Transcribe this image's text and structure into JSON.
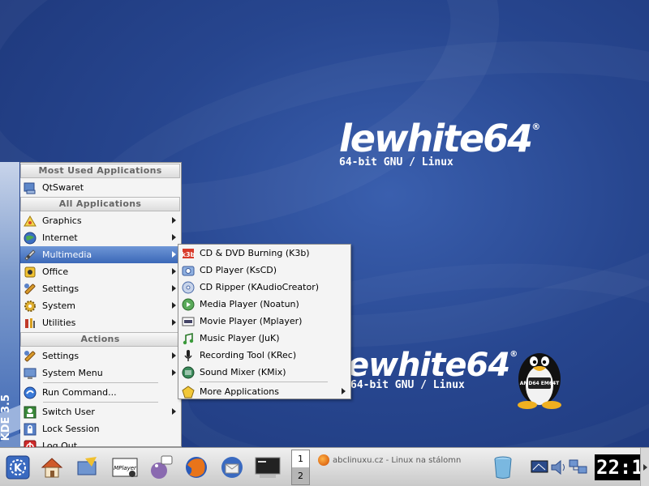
{
  "desktop": {
    "brand_top": "lewhite64",
    "brand_top_mark": "®",
    "sub_top": "64-bit GNU / Linux",
    "brand_bottom": "ewhite64",
    "brand_bottom_mark": "®",
    "sub_bottom": "64-bit GNU / Linux",
    "tux_badge": "AMD64 EM64T"
  },
  "sidebar": {
    "label": "KDE 3.5"
  },
  "menu": {
    "header_most_used": "Most Used Applications",
    "most_used": [
      {
        "label": "QtSwaret",
        "icon": "qtswaret-icon"
      }
    ],
    "header_all": "All Applications",
    "all": [
      {
        "label": "Graphics",
        "icon": "graphics-icon",
        "submenu": true
      },
      {
        "label": "Internet",
        "icon": "internet-globe-icon",
        "submenu": true
      },
      {
        "label": "Multimedia",
        "icon": "multimedia-icon",
        "submenu": true,
        "active": true
      },
      {
        "label": "Office",
        "icon": "office-icon",
        "submenu": true
      },
      {
        "label": "Settings",
        "icon": "settings-wrench-icon",
        "submenu": true
      },
      {
        "label": "System",
        "icon": "system-gear-icon",
        "submenu": true
      },
      {
        "label": "Utilities",
        "icon": "utilities-icon",
        "submenu": true
      }
    ],
    "header_actions": "Actions",
    "actions": [
      {
        "label": "Settings",
        "icon": "settings-wrench-icon",
        "submenu": true
      },
      {
        "label": "System Menu",
        "icon": "system-menu-icon",
        "submenu": true
      },
      {
        "label": "Run Command...",
        "icon": "run-command-icon",
        "submenu": false
      },
      {
        "label": "Switch User",
        "icon": "switch-user-icon",
        "submenu": true
      },
      {
        "label": "Lock Session",
        "icon": "lock-icon",
        "submenu": false
      },
      {
        "label": "Log Out...",
        "icon": "logout-icon",
        "submenu": false
      }
    ]
  },
  "submenu": {
    "items": [
      {
        "label": "CD & DVD Burning (K3b)",
        "icon": "k3b-icon"
      },
      {
        "label": "CD Player (KsCD)",
        "icon": "cd-player-icon"
      },
      {
        "label": "CD Ripper (KAudioCreator)",
        "icon": "cd-ripper-icon"
      },
      {
        "label": "Media Player (Noatun)",
        "icon": "noatun-icon"
      },
      {
        "label": "Movie Player (Mplayer)",
        "icon": "mplayer-icon"
      },
      {
        "label": "Music Player (JuK)",
        "icon": "juk-icon"
      },
      {
        "label": "Recording Tool (KRec)",
        "icon": "krec-icon"
      },
      {
        "label": "Sound Mixer (KMix)",
        "icon": "kmix-icon"
      }
    ],
    "more": {
      "label": "More Applications",
      "icon": "more-apps-icon"
    }
  },
  "taskbar": {
    "pager": [
      "1",
      "2"
    ],
    "task_label": "abclinuxu.cz - Linux na stálomn",
    "clock": "22:1",
    "launcher_mplayer_label": "MPlayer"
  },
  "colors": {
    "highlight": "#3b68b8",
    "desktop": "#27468f"
  }
}
